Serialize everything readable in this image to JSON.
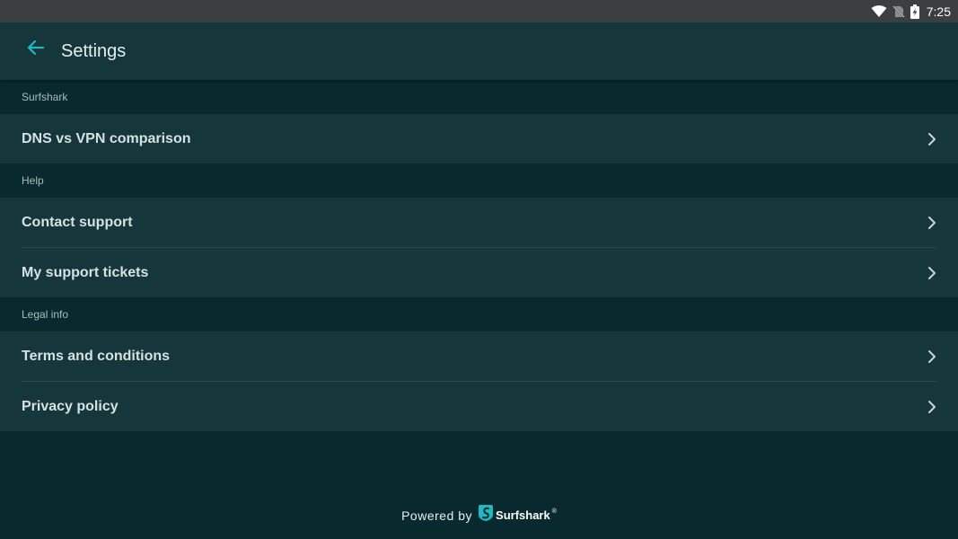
{
  "status_bar": {
    "time": "7:25",
    "icons": [
      "wifi-icon",
      "no-sim-icon",
      "battery-charging-icon"
    ]
  },
  "header": {
    "title": "Settings",
    "back_icon": "arrow-left-icon",
    "accent_color": "#1fb8c3"
  },
  "sections": [
    {
      "header": "Surfshark",
      "items": [
        {
          "label": "DNS vs VPN comparison",
          "icon": "chevron-right-icon"
        }
      ]
    },
    {
      "header": "Help",
      "items": [
        {
          "label": "Contact support",
          "icon": "chevron-right-icon"
        },
        {
          "label": "My support tickets",
          "icon": "chevron-right-icon"
        }
      ]
    },
    {
      "header": "Legal info",
      "items": [
        {
          "label": "Terms and conditions",
          "icon": "chevron-right-icon"
        },
        {
          "label": "Privacy policy",
          "icon": "chevron-right-icon"
        }
      ]
    }
  ],
  "footer": {
    "powered_by": "Powered by",
    "brand": "Surfshark",
    "registered_mark": "®",
    "brand_icon": "surfshark-logo-icon"
  }
}
